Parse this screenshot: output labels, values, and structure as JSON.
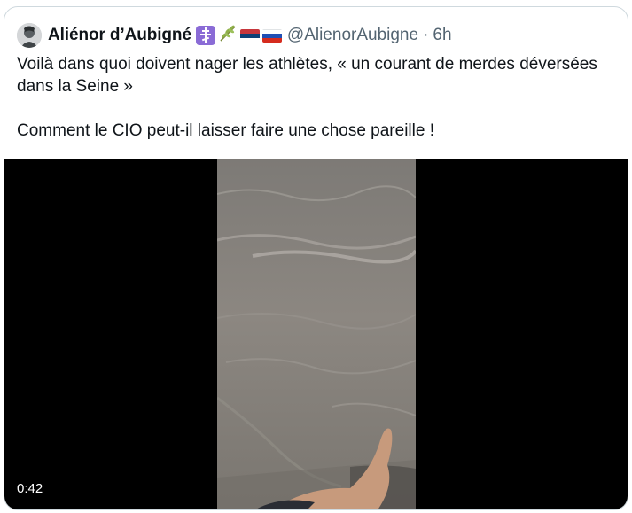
{
  "tweet": {
    "author_name": "Aliénor d’Aubigné",
    "handle": "@AlienorAubigne",
    "separator": "·",
    "time": "6h",
    "badges": [
      "orthodox-cross-icon",
      "olive-branch-icon",
      "serbia-flag-icon",
      "russia-flag-icon"
    ],
    "text_paragraphs": [
      "Voilà dans quoi doivent nager les athlètes, « un courant de merdes déversées dans la Seine »",
      "Comment le CIO peut-il laisser faire une chose pareille !"
    ]
  },
  "media": {
    "duration": "0:42"
  },
  "colors": {
    "secondary_text": "#536471",
    "border": "#cfd9de",
    "video_background": "#000000"
  }
}
